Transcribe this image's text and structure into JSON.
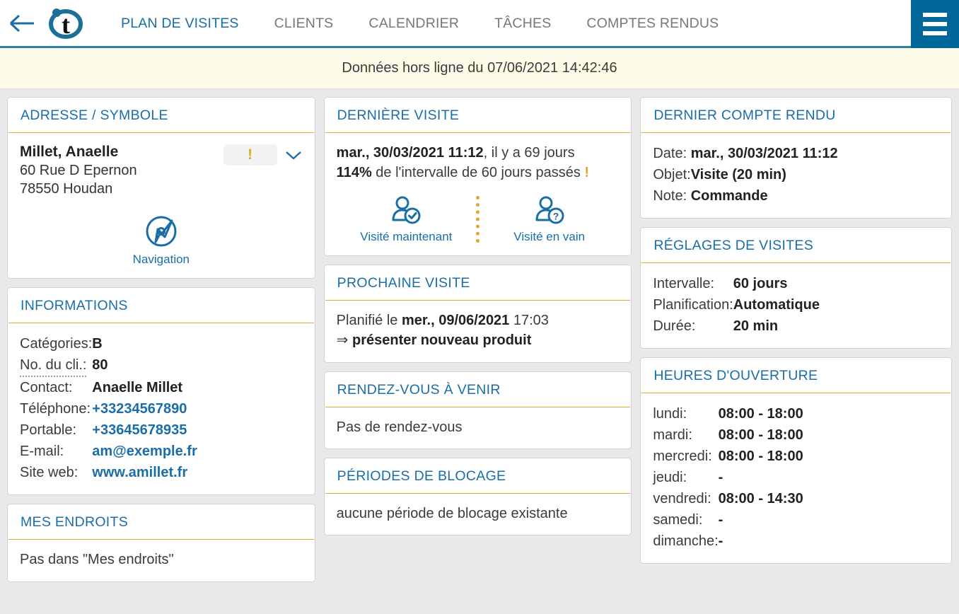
{
  "header": {
    "back_icon": "back-arrow-icon",
    "logo_letter": "t",
    "menu_icon": "hamburger-menu-icon",
    "tabs": [
      {
        "label": "PLAN DE VISITES",
        "active": true
      },
      {
        "label": "CLIENTS",
        "active": false
      },
      {
        "label": "CALENDRIER",
        "active": false
      },
      {
        "label": "TÂCHES",
        "active": false
      },
      {
        "label": "COMPTES RENDUS",
        "active": false
      }
    ]
  },
  "offline_banner": {
    "text": "Données hors ligne du 07/06/2021 14:42:46"
  },
  "address_card": {
    "title": "ADRESSE / SYMBOLE",
    "name": "Millet, Anaelle",
    "street": "60 Rue D Epernon",
    "city": "78550 Houdan",
    "alert_symbol": "!",
    "expand_icon": "chevron-down-icon",
    "navigation_icon": "navigation-compass-icon",
    "navigation_label": "Navigation"
  },
  "informations_card": {
    "title": "INFORMATIONS",
    "rows": [
      {
        "key": "Catégories:",
        "value": "B",
        "link": false,
        "dotted": false
      },
      {
        "key": "No. du cli.:",
        "value": "80",
        "link": false,
        "dotted": true
      },
      {
        "key": "Contact:",
        "value": "Anaelle Millet",
        "link": false,
        "dotted": false
      },
      {
        "key": "Téléphone:",
        "value": "+33234567890",
        "link": true,
        "dotted": false
      },
      {
        "key": "Portable:",
        "value": "+33645678935",
        "link": true,
        "dotted": false
      },
      {
        "key": "E-mail:",
        "value": "am@exemple.fr",
        "link": true,
        "dotted": false
      },
      {
        "key": "Site web:",
        "value": "www.amillet.fr",
        "link": true,
        "dotted": false
      }
    ]
  },
  "mes_endroits_card": {
    "title": "MES ENDROITS",
    "body": "Pas dans \"Mes endroits\""
  },
  "derniere_visite_card": {
    "title": "DERNIÈRE VISITE",
    "date": "mar., 30/03/2021 11:12",
    "since": ", il y a 69 jours",
    "percent": "114%",
    "interval_text": " de l'intervalle de 60 jours passés ",
    "warn_symbol": "!",
    "action_visited": {
      "icon": "person-check-icon",
      "label": "Visité maintenant"
    },
    "action_invain": {
      "icon": "person-question-icon",
      "label": "Visité en vain"
    }
  },
  "prochaine_visite_card": {
    "title": "PROCHAINE VISITE",
    "prefix": "Planifié le ",
    "date": "mer., 09/06/2021",
    "time": " 17:03",
    "arrow": "⇒ ",
    "note": "présenter nouveau produit"
  },
  "rendezvous_card": {
    "title": "RENDEZ-VOUS À VENIR",
    "body": "Pas de rendez-vous"
  },
  "blocage_card": {
    "title": "PÉRIODES DE BLOCAGE",
    "body": "aucune période de blocage existante"
  },
  "compte_rendu_card": {
    "title": "DERNIER COMPTE RENDU",
    "rows": [
      {
        "key": "Date:",
        "value": "mar., 30/03/2021 11:12"
      },
      {
        "key": "Objet:",
        "value": "Visite (20 min)"
      },
      {
        "key": "Note:",
        "value": "Commande"
      }
    ]
  },
  "reglages_card": {
    "title": "RÉGLAGES DE VISITES",
    "rows": [
      {
        "key": "Intervalle:",
        "value": "60 jours"
      },
      {
        "key": "Planification:",
        "value": "Automatique"
      },
      {
        "key": "Durée:",
        "value": "20 min"
      }
    ]
  },
  "heures_card": {
    "title": "HEURES D'OUVERTURE",
    "rows": [
      {
        "key": "lundi:",
        "value": "08:00 - 18:00"
      },
      {
        "key": "mardi:",
        "value": "08:00 - 18:00"
      },
      {
        "key": "mercredi:",
        "value": "08:00 - 18:00"
      },
      {
        "key": "jeudi:",
        "value": "-"
      },
      {
        "key": "vendredi:",
        "value": "08:00 - 14:30"
      },
      {
        "key": "samedi:",
        "value": "-"
      },
      {
        "key": "dimanche:",
        "value": "-"
      }
    ]
  },
  "colors": {
    "accent_blue": "#1a6ea8",
    "header_blue": "#00679b",
    "gold": "#e0a82e",
    "page_bg": "#e9e9e9",
    "banner_bg": "#fcfce8"
  }
}
